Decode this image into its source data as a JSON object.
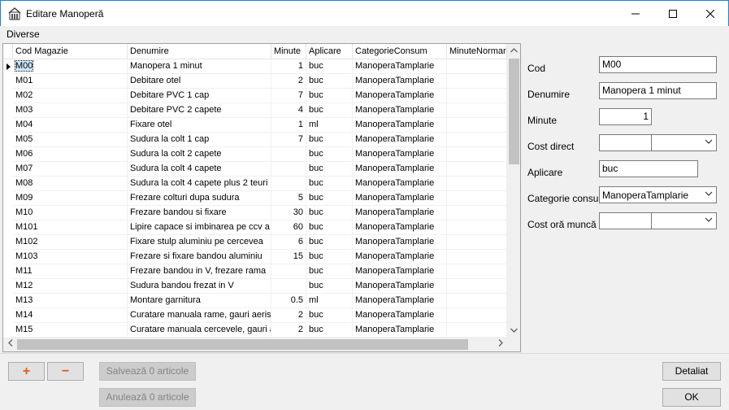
{
  "window": {
    "title": "Editare Manoperă"
  },
  "menu": {
    "items": [
      "Diverse"
    ]
  },
  "grid": {
    "columns": [
      "Cod Magazie",
      "Denumire",
      "Minute",
      "Aplicare",
      "CategorieConsum",
      "MinuteNormare"
    ],
    "rows": [
      {
        "cod": "M00",
        "denumire": "Manopera 1 minut",
        "minute": "1",
        "aplicare": "buc",
        "categorie": "ManoperaTamplarie",
        "normare": ""
      },
      {
        "cod": "M01",
        "denumire": "Debitare otel",
        "minute": "2",
        "aplicare": "buc",
        "categorie": "ManoperaTamplarie",
        "normare": ""
      },
      {
        "cod": "M02",
        "denumire": "Debitare PVC 1 cap",
        "minute": "7",
        "aplicare": "buc",
        "categorie": "ManoperaTamplarie",
        "normare": ""
      },
      {
        "cod": "M03",
        "denumire": "Debitare PVC 2 capete",
        "minute": "4",
        "aplicare": "buc",
        "categorie": "ManoperaTamplarie",
        "normare": ""
      },
      {
        "cod": "M04",
        "denumire": "Fixare otel",
        "minute": "1",
        "aplicare": "ml",
        "categorie": "ManoperaTamplarie",
        "normare": ""
      },
      {
        "cod": "M05",
        "denumire": "Sudura la colt 1 cap",
        "minute": "7",
        "aplicare": "buc",
        "categorie": "ManoperaTamplarie",
        "normare": ""
      },
      {
        "cod": "M06",
        "denumire": "Sudura la colt 2 capete",
        "minute": "",
        "aplicare": "buc",
        "categorie": "ManoperaTamplarie",
        "normare": ""
      },
      {
        "cod": "M07",
        "denumire": "Sudura la colt 4 capete",
        "minute": "",
        "aplicare": "buc",
        "categorie": "ManoperaTamplarie",
        "normare": ""
      },
      {
        "cod": "M08",
        "denumire": "Sudura la colt 4 capete plus 2 teuri",
        "minute": "",
        "aplicare": "buc",
        "categorie": "ManoperaTamplarie",
        "normare": ""
      },
      {
        "cod": "M09",
        "denumire": "Frezare colturi dupa sudura",
        "minute": "5",
        "aplicare": "buc",
        "categorie": "ManoperaTamplarie",
        "normare": ""
      },
      {
        "cod": "M10",
        "denumire": "Frezare bandou si fixare",
        "minute": "30",
        "aplicare": "buc",
        "categorie": "ManoperaTamplarie",
        "normare": ""
      },
      {
        "cod": "M101",
        "denumire": "Lipire capace si imbinarea pe ccv a stulp",
        "minute": "60",
        "aplicare": "buc",
        "categorie": "ManoperaTamplarie",
        "normare": ""
      },
      {
        "cod": "M102",
        "denumire": "Fixare stulp aluminiu pe cercevea",
        "minute": "6",
        "aplicare": "buc",
        "categorie": "ManoperaTamplarie",
        "normare": ""
      },
      {
        "cod": "M103",
        "denumire": "Frezare si fixare bandou aluminiu",
        "minute": "15",
        "aplicare": "buc",
        "categorie": "ManoperaTamplarie",
        "normare": ""
      },
      {
        "cod": "M11",
        "denumire": "Frezare bandou in V, frezare rama",
        "minute": "",
        "aplicare": "buc",
        "categorie": "ManoperaTamplarie",
        "normare": ""
      },
      {
        "cod": "M12",
        "denumire": "Sudura bandou frezat in V",
        "minute": "",
        "aplicare": "buc",
        "categorie": "ManoperaTamplarie",
        "normare": ""
      },
      {
        "cod": "M13",
        "denumire": "Montare garnitura",
        "minute": "0.5",
        "aplicare": "ml",
        "categorie": "ManoperaTamplarie",
        "normare": ""
      },
      {
        "cod": "M14",
        "denumire": "Curatare manuala rame, gauri aerisire",
        "minute": "2",
        "aplicare": "buc",
        "categorie": "ManoperaTamplarie",
        "normare": ""
      },
      {
        "cod": "M15",
        "denumire": "Curatare manuala cercevele, gauri aerisire",
        "minute": "2",
        "aplicare": "buc",
        "categorie": "ManoperaTamplarie",
        "normare": ""
      }
    ]
  },
  "form": {
    "cod_label": "Cod",
    "cod_value": "M00",
    "denumire_label": "Denumire",
    "denumire_value": "Manopera 1 minut",
    "minute_label": "Minute",
    "minute_value": "1",
    "cost_direct_label": "Cost direct",
    "aplicare_label": "Aplicare",
    "aplicare_value": "buc",
    "categorie_label": "Categorie consum",
    "categorie_value": "ManoperaTamplarie",
    "cost_ora_label": "Cost oră muncă"
  },
  "buttons": {
    "add": "+",
    "remove": "−",
    "save": "Salvează 0 articole",
    "cancel": "Anulează 0 articole",
    "details": "Detaliat",
    "ok": "OK"
  },
  "colors": {
    "title_border": "#1883d7",
    "selection": "#cce8ff",
    "accent_orange": "#e05a1a"
  }
}
